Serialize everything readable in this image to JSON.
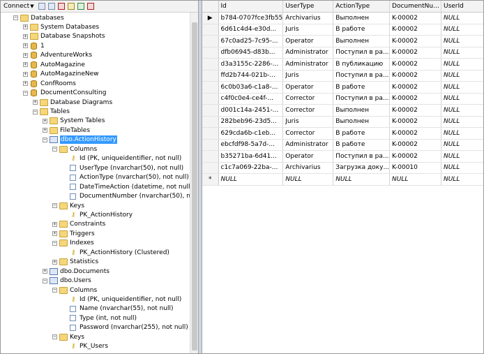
{
  "toolbar": {
    "connect_label": "Connect"
  },
  "tree": [
    {
      "label": "Databases",
      "icon": "folder",
      "exp": "-"
    },
    {
      "label": "System Databases",
      "icon": "folder",
      "exp": "+"
    },
    {
      "label": "Database Snapshots",
      "icon": "folder",
      "exp": "+"
    },
    {
      "label": "1",
      "icon": "db",
      "exp": "+"
    },
    {
      "label": "AdventureWorks",
      "icon": "db",
      "exp": "+"
    },
    {
      "label": "AutoMagazine",
      "icon": "db",
      "exp": "+"
    },
    {
      "label": "AutoMagazineNew",
      "icon": "db",
      "exp": "+"
    },
    {
      "label": "ConfRooms",
      "icon": "db",
      "exp": "+"
    },
    {
      "label": "DocumentConsulting",
      "icon": "db",
      "exp": "-"
    },
    {
      "label": "Database Diagrams",
      "icon": "folder",
      "exp": "+"
    },
    {
      "label": "Tables",
      "icon": "folder",
      "exp": "-"
    },
    {
      "label": "System Tables",
      "icon": "folder",
      "exp": "+"
    },
    {
      "label": "FileTables",
      "icon": "folder",
      "exp": "+"
    },
    {
      "label": "dbo.ActionHistory",
      "icon": "table",
      "exp": "-",
      "selected": true
    },
    {
      "label": "Columns",
      "icon": "folder",
      "exp": "-"
    },
    {
      "label": "Id (PK, uniqueidentifier, not null)",
      "icon": "key",
      "exp": ""
    },
    {
      "label": "UserType (nvarchar(50), not null)",
      "icon": "column",
      "exp": ""
    },
    {
      "label": "ActionType (nvarchar(50), not null)",
      "icon": "column",
      "exp": ""
    },
    {
      "label": "DateTimeAction (datetime, not null)",
      "icon": "column",
      "exp": ""
    },
    {
      "label": "DocumentNumber (nvarchar(50), not n",
      "icon": "column",
      "exp": ""
    },
    {
      "label": "Keys",
      "icon": "folder",
      "exp": "-"
    },
    {
      "label": "PK_ActionHistory",
      "icon": "key",
      "exp": ""
    },
    {
      "label": "Constraints",
      "icon": "folder",
      "exp": "+"
    },
    {
      "label": "Triggers",
      "icon": "folder",
      "exp": "+"
    },
    {
      "label": "Indexes",
      "icon": "folder",
      "exp": "-"
    },
    {
      "label": "PK_ActionHistory (Clustered)",
      "icon": "key",
      "exp": ""
    },
    {
      "label": "Statistics",
      "icon": "folder",
      "exp": "+"
    },
    {
      "label": "dbo.Documents",
      "icon": "table",
      "exp": "+"
    },
    {
      "label": "dbo.Users",
      "icon": "table",
      "exp": "-"
    },
    {
      "label": "Columns",
      "icon": "folder",
      "exp": "-"
    },
    {
      "label": "Id (PK, uniqueidentifier, not null)",
      "icon": "key",
      "exp": ""
    },
    {
      "label": "Name (nvarchar(55), not null)",
      "icon": "column",
      "exp": ""
    },
    {
      "label": "Type (int, not null)",
      "icon": "column",
      "exp": ""
    },
    {
      "label": "Password (nvarchar(255), not null)",
      "icon": "column",
      "exp": ""
    },
    {
      "label": "Keys",
      "icon": "folder",
      "exp": "-"
    },
    {
      "label": "PK_Users",
      "icon": "key",
      "exp": ""
    }
  ],
  "grid": {
    "columns": [
      "Id",
      "UserType",
      "ActionType",
      "DocumentNu...",
      "UserId"
    ],
    "rows": [
      [
        "▶",
        "b784-0707fce3fb55",
        "Archivarius",
        "Выполнен",
        "K-00002",
        "NULL"
      ],
      [
        "",
        "6d61c4d4-e30d...",
        "Juris",
        "В работе",
        "K-00002",
        "NULL"
      ],
      [
        "",
        "67c0ad25-7c95-...",
        "Operator",
        "Выполнен",
        "K-00002",
        "NULL"
      ],
      [
        "",
        "dfb06945-d83b...",
        "Administrator",
        "Поступил в ра...",
        "K-00002",
        "NULL"
      ],
      [
        "",
        "d3a3155c-2286-...",
        "Administrator",
        "В публикацию",
        "K-00002",
        "NULL"
      ],
      [
        "",
        "ffd2b744-021b-...",
        "Juris",
        "Поступил в ра...",
        "K-00002",
        "NULL"
      ],
      [
        "",
        "6c0b03a6-c1a8-...",
        "Operator",
        "В работе",
        "K-00002",
        "NULL"
      ],
      [
        "",
        "c4f0c0e4-ce4f-...",
        "Corrector",
        "Поступил в ра...",
        "K-00002",
        "NULL"
      ],
      [
        "",
        "d001c14a-2451-...",
        "Corrector",
        "Выполнен",
        "K-00002",
        "NULL"
      ],
      [
        "",
        "282beb96-23d5...",
        "Juris",
        "Выполнен",
        "K-00002",
        "NULL"
      ],
      [
        "",
        "629cda6b-c1eb...",
        "Corrector",
        "В работе",
        "K-00002",
        "NULL"
      ],
      [
        "",
        "ebcfdf98-5a7d-...",
        "Administrator",
        "В работе",
        "K-00002",
        "NULL"
      ],
      [
        "",
        "b35271ba-6d41...",
        "Operator",
        "Поступил в ра...",
        "K-00002",
        "NULL"
      ],
      [
        "",
        "c1c7a069-22ba-...",
        "Archivarius",
        "Загрузка доку...",
        "K-00010",
        "NULL"
      ],
      [
        "*",
        "NULL",
        "NULL",
        "NULL",
        "NULL",
        "NULL"
      ]
    ]
  }
}
